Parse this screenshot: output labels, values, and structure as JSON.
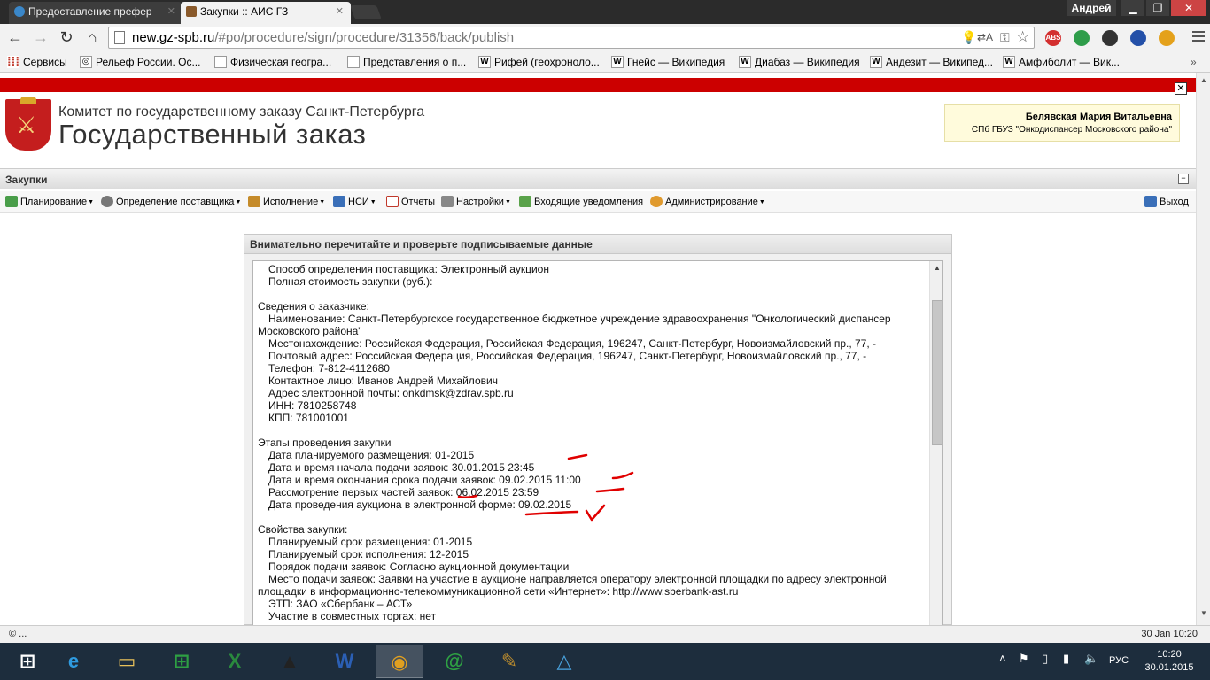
{
  "browser": {
    "tabs": [
      {
        "title": "Предоставление префер",
        "state": "inactive"
      },
      {
        "title": "Закупки :: АИС ГЗ",
        "state": "active"
      }
    ],
    "user": "Андрей",
    "url_domain": "new.gz-spb.ru",
    "url_path": "/#po/procedure/sign/procedure/31356/back/publish",
    "bookmarks": [
      {
        "label": "Сервисы",
        "icon": "apps-icon"
      },
      {
        "label": "Рельеф России. Ос...",
        "icon": "page-icon"
      },
      {
        "label": "Физическая геогра...",
        "icon": "page-icon"
      },
      {
        "label": "Представления о п...",
        "icon": "page-icon"
      },
      {
        "label": "Рифей (геохроноло...",
        "icon": "wikipedia-icon"
      },
      {
        "label": "Гнейс — Википедия",
        "icon": "wikipedia-icon"
      },
      {
        "label": "Диабаз — Википедия",
        "icon": "wikipedia-icon"
      },
      {
        "label": "Андезит — Википед...",
        "icon": "wikipedia-icon"
      },
      {
        "label": "Амфиболит — Вик...",
        "icon": "wikipedia-icon"
      }
    ],
    "extensions": {
      "abs": "ABS"
    }
  },
  "header": {
    "org_line": "Комитет по государственному заказу Санкт-Петербурга",
    "org_big": "Государственный заказ",
    "user_name": "Белявская Мария Витальевна",
    "user_org": "СПб ГБУЗ \"Онкодиспансер Московского района\""
  },
  "section": {
    "title": "Закупки"
  },
  "menu": {
    "items": [
      {
        "label": "Планирование",
        "dropdown": true
      },
      {
        "label": "Определение поставщика",
        "dropdown": true
      },
      {
        "label": "Исполнение",
        "dropdown": true
      },
      {
        "label": "НСИ",
        "dropdown": true
      },
      {
        "label": "Отчеты",
        "dropdown": false
      },
      {
        "label": "Настройки",
        "dropdown": true
      },
      {
        "label": "Входящие уведомления",
        "dropdown": false
      },
      {
        "label": "Администрирование",
        "dropdown": true
      }
    ],
    "exit": "Выход"
  },
  "dialog": {
    "title": "Внимательно перечитайте и проверьте подписываемые данные",
    "lines": [
      {
        "t": "Способ определения поставщика: Электронный аукцион",
        "i": 1
      },
      {
        "t": "Полная стоимость закупки (руб.):",
        "i": 1
      },
      {
        "t": "",
        "i": 0
      },
      {
        "t": "Сведения о заказчике:",
        "i": 0
      },
      {
        "t": "Наименование: Санкт-Петербургское государственное бюджетное учреждение здравоохранения \"Онкологический диспансер",
        "i": 1
      },
      {
        "t": "Московского района\"",
        "i": 0
      },
      {
        "t": "Местонахождение: Российская Федерация, Российская Федерация, 196247, Санкт-Петербург, Новоизмайловский пр., 77, -",
        "i": 1
      },
      {
        "t": "Почтовый адрес: Российская Федерация, Российская Федерация, 196247, Санкт-Петербург, Новоизмайловский пр., 77, -",
        "i": 1
      },
      {
        "t": "Телефон: 7-812-4112680",
        "i": 1
      },
      {
        "t": "Контактное лицо: Иванов Андрей Михайлович",
        "i": 1
      },
      {
        "t": "Адрес электронной почты: onkdmsk@zdrav.spb.ru",
        "i": 1
      },
      {
        "t": "ИНН: 7810258748",
        "i": 1
      },
      {
        "t": "КПП: 781001001",
        "i": 1
      },
      {
        "t": "",
        "i": 0
      },
      {
        "t": "Этапы проведения закупки",
        "i": 0
      },
      {
        "t": "Дата планируемого размещения: 01-2015",
        "i": 1
      },
      {
        "t": "Дата и время начала подачи заявок: 30.01.2015 23:45",
        "i": 1
      },
      {
        "t": "Дата и время окончания срока подачи заявок: 09.02.2015 11:00",
        "i": 1
      },
      {
        "t": "Рассмотрение первых частей заявок: 06.02.2015 23:59",
        "i": 1
      },
      {
        "t": "Дата проведения аукциона в электронной форме: 09.02.2015",
        "i": 1
      },
      {
        "t": "",
        "i": 0
      },
      {
        "t": "Свойства закупки:",
        "i": 0
      },
      {
        "t": "Планируемый срок размещения: 01-2015",
        "i": 1
      },
      {
        "t": "Планируемый срок исполнения: 12-2015",
        "i": 1
      },
      {
        "t": "Порядок подачи заявок: Согласно аукционной документации",
        "i": 1
      },
      {
        "t": "Место подачи заявок: Заявки на участие в аукционе направляется оператору электронной площадки по адресу электронной",
        "i": 1
      },
      {
        "t": "площадки в информационно-телекоммуникационной сети «Интернет»: http://www.sberbank-ast.ru",
        "i": 0
      },
      {
        "t": "ЭТП: ЗАО «Сбербанк – АСТ»",
        "i": 1
      },
      {
        "t": "Участие в совместных торгах: нет",
        "i": 1
      }
    ]
  },
  "statusbar": {
    "left": "© ...",
    "right": "30 Jan 10:20"
  },
  "taskbar": {
    "lang": "РУС",
    "time": "10:20",
    "date": "30.01.2015"
  },
  "colors": {
    "accent_red": "#cc0000",
    "annotation_red": "#e00000",
    "taskbar": "#1d2d3d"
  }
}
